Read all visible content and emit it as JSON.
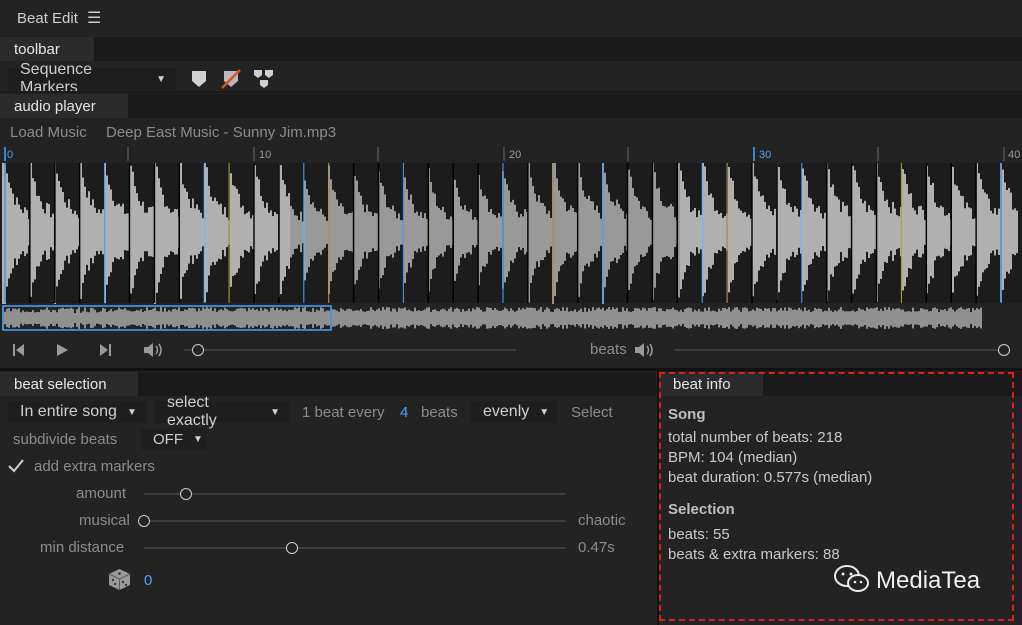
{
  "window": {
    "title": "Beat Edit"
  },
  "toolbar": {
    "tab": "toolbar",
    "marker_dropdown": "Sequence Markers"
  },
  "audio_player": {
    "tab": "audio player",
    "load_music": "Load Music",
    "file_name": "Deep East Music - Sunny Jim.mp3",
    "timeline_labels": [
      "0",
      "10",
      "20",
      "30",
      "40"
    ],
    "beats_label": "beats"
  },
  "beat_selection": {
    "tab": "beat selection",
    "scope_dropdown": "In entire song",
    "mode_dropdown": "select exactly",
    "every_prefix": "1 beat every",
    "every_value": "4",
    "every_suffix": "beats",
    "distribution_dropdown": "evenly",
    "select_button": "Select",
    "subdivide_label": "subdivide beats",
    "subdivide_value": "OFF",
    "extra_markers_label": "add extra markers",
    "extra_markers_checked": true,
    "amount_label": "amount",
    "amount_level": 0.1,
    "musical_label": "musical",
    "chaotic_label": "chaotic",
    "musical_level": 0.0,
    "min_distance_label": "min distance",
    "min_distance_level": 0.35,
    "min_distance_value": "0.47s",
    "seed_value": "0"
  },
  "beat_info": {
    "tab": "beat info",
    "song_heading": "Song",
    "total_beats": "total number of beats: 218",
    "bpm": "BPM: 104 (median)",
    "beat_duration": "beat duration: 0.577s (median)",
    "selection_heading": "Selection",
    "beats": "beats: 55",
    "beats_extra": "beats & extra markers: 88"
  },
  "watermark": {
    "text": "MediaTea"
  },
  "colors": {
    "accent": "#4aa3ff",
    "highlight_box": "#d9201f",
    "background": "#232323",
    "waveform": "#cfcfcf"
  }
}
